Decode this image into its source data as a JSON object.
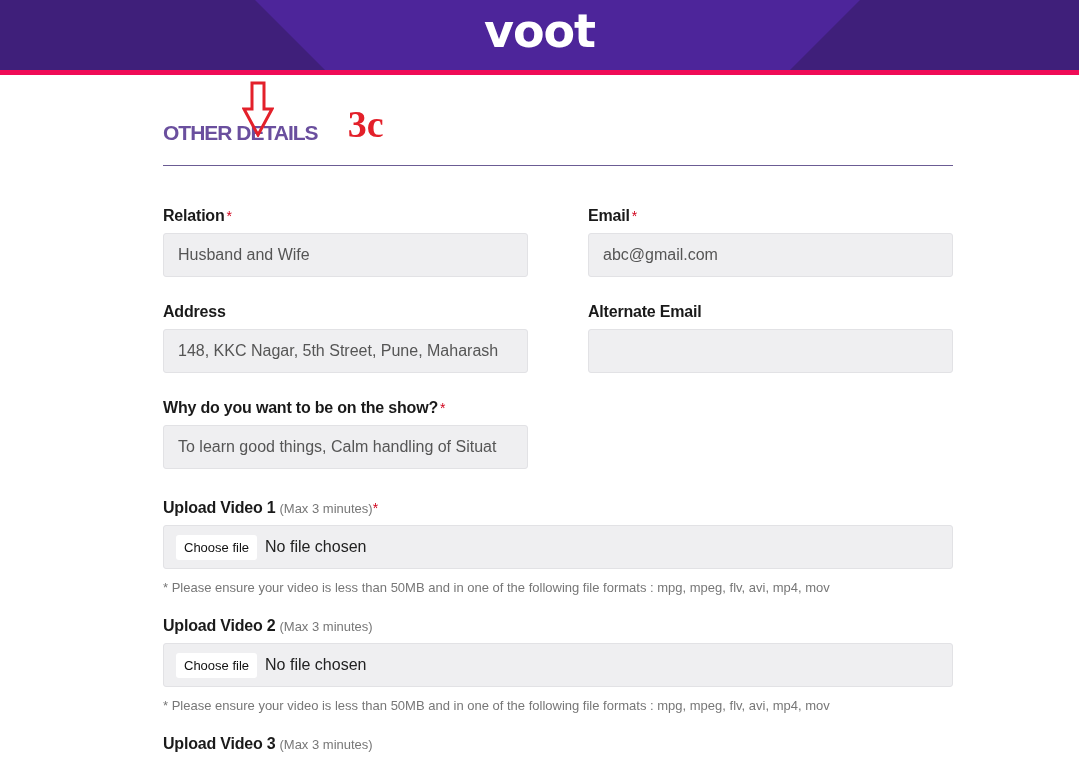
{
  "header": {
    "logo": "voot"
  },
  "section": {
    "title": "OTHER DETAILS",
    "annotation": "3c"
  },
  "rows": [
    {
      "fields": [
        {
          "label": "Relation",
          "required_mark": "*",
          "value": "Husband and Wife"
        },
        {
          "label": "Email",
          "required_mark": "*",
          "value": "abc@gmail.com"
        }
      ]
    },
    {
      "fields": [
        {
          "label": "Address",
          "value": "148, KKC Nagar, 5th Street, Pune, Maharash"
        },
        {
          "label": "Alternate Email"
        }
      ]
    },
    {
      "fields": [
        {
          "label": "Why do you want to be on the show?",
          "required_mark": "*",
          "value": "To learn good things, Calm handling of Situat"
        }
      ]
    }
  ],
  "uploads": [
    {
      "label": "Upload Video 1",
      "hint": "(Max 3 minutes)",
      "required_mark": "*",
      "button": "Choose file",
      "status": "No file chosen",
      "note": "* Please ensure your video is less than 50MB and in one of the following file formats : mpg, mpeg, flv, avi, mp4, mov"
    },
    {
      "label": "Upload Video 2",
      "hint": "(Max 3 minutes)",
      "button": "Choose file",
      "status": "No file chosen",
      "note": "* Please ensure your video is less than 50MB and in one of the following file formats : mpg, mpeg, flv, avi, mp4, mov"
    },
    {
      "label": "Upload Video 3",
      "hint": "(Max 3 minutes)"
    }
  ]
}
